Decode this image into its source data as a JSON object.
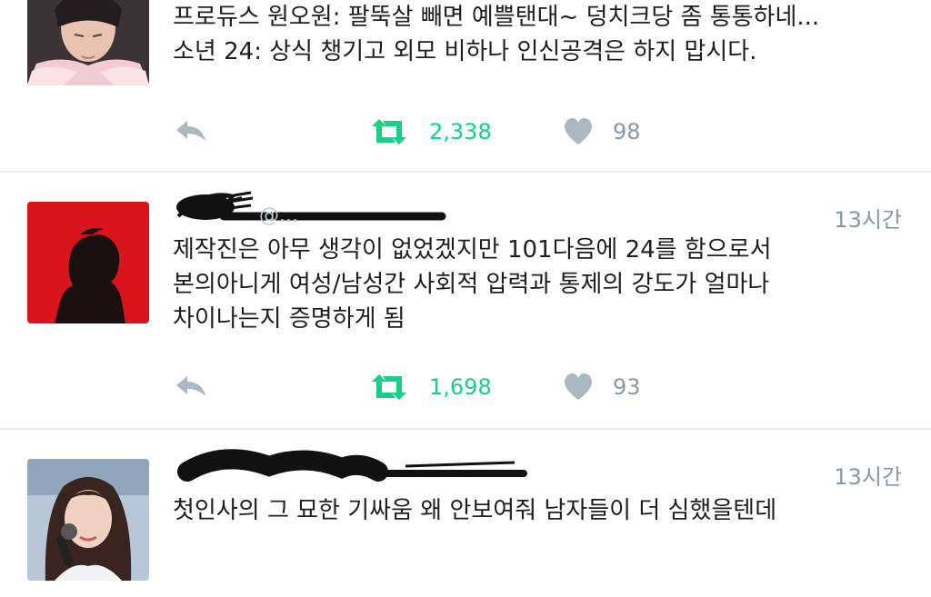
{
  "tweets": [
    {
      "lines": [
        "프로듀스 원오원: 팔뚝살 빼면 예쁠탠대~ 덩치크당 좀 통통하네...",
        "소년 24: 상식 챙기고 외모 비하나 인신공격은 하지 맙시다."
      ],
      "retweets": "2,338",
      "likes": "98"
    },
    {
      "handle": "@...",
      "time": "13시간",
      "lines": [
        "제작진은 아무 생각이 없었겠지만 101다음에 24를 함으로서",
        "본의아니게 여성/남성간 사회적 압력과 통제의 강도가 얼마나",
        "차이나는지 증명하게 됨"
      ],
      "retweets": "1,698",
      "likes": "93"
    },
    {
      "time": "13시간",
      "lines": [
        "첫인사의 그 묘한 기싸움 왜 안보여줘 남자들이 더 심했을텐데"
      ]
    }
  ],
  "colors": {
    "retweet_green": "#19cf86",
    "icon_gray": "#8899a6",
    "divider": "#e6ecf0",
    "avatar2_red": "#d9141c"
  },
  "icons": [
    "reply-icon",
    "retweet-icon",
    "heart-icon"
  ]
}
